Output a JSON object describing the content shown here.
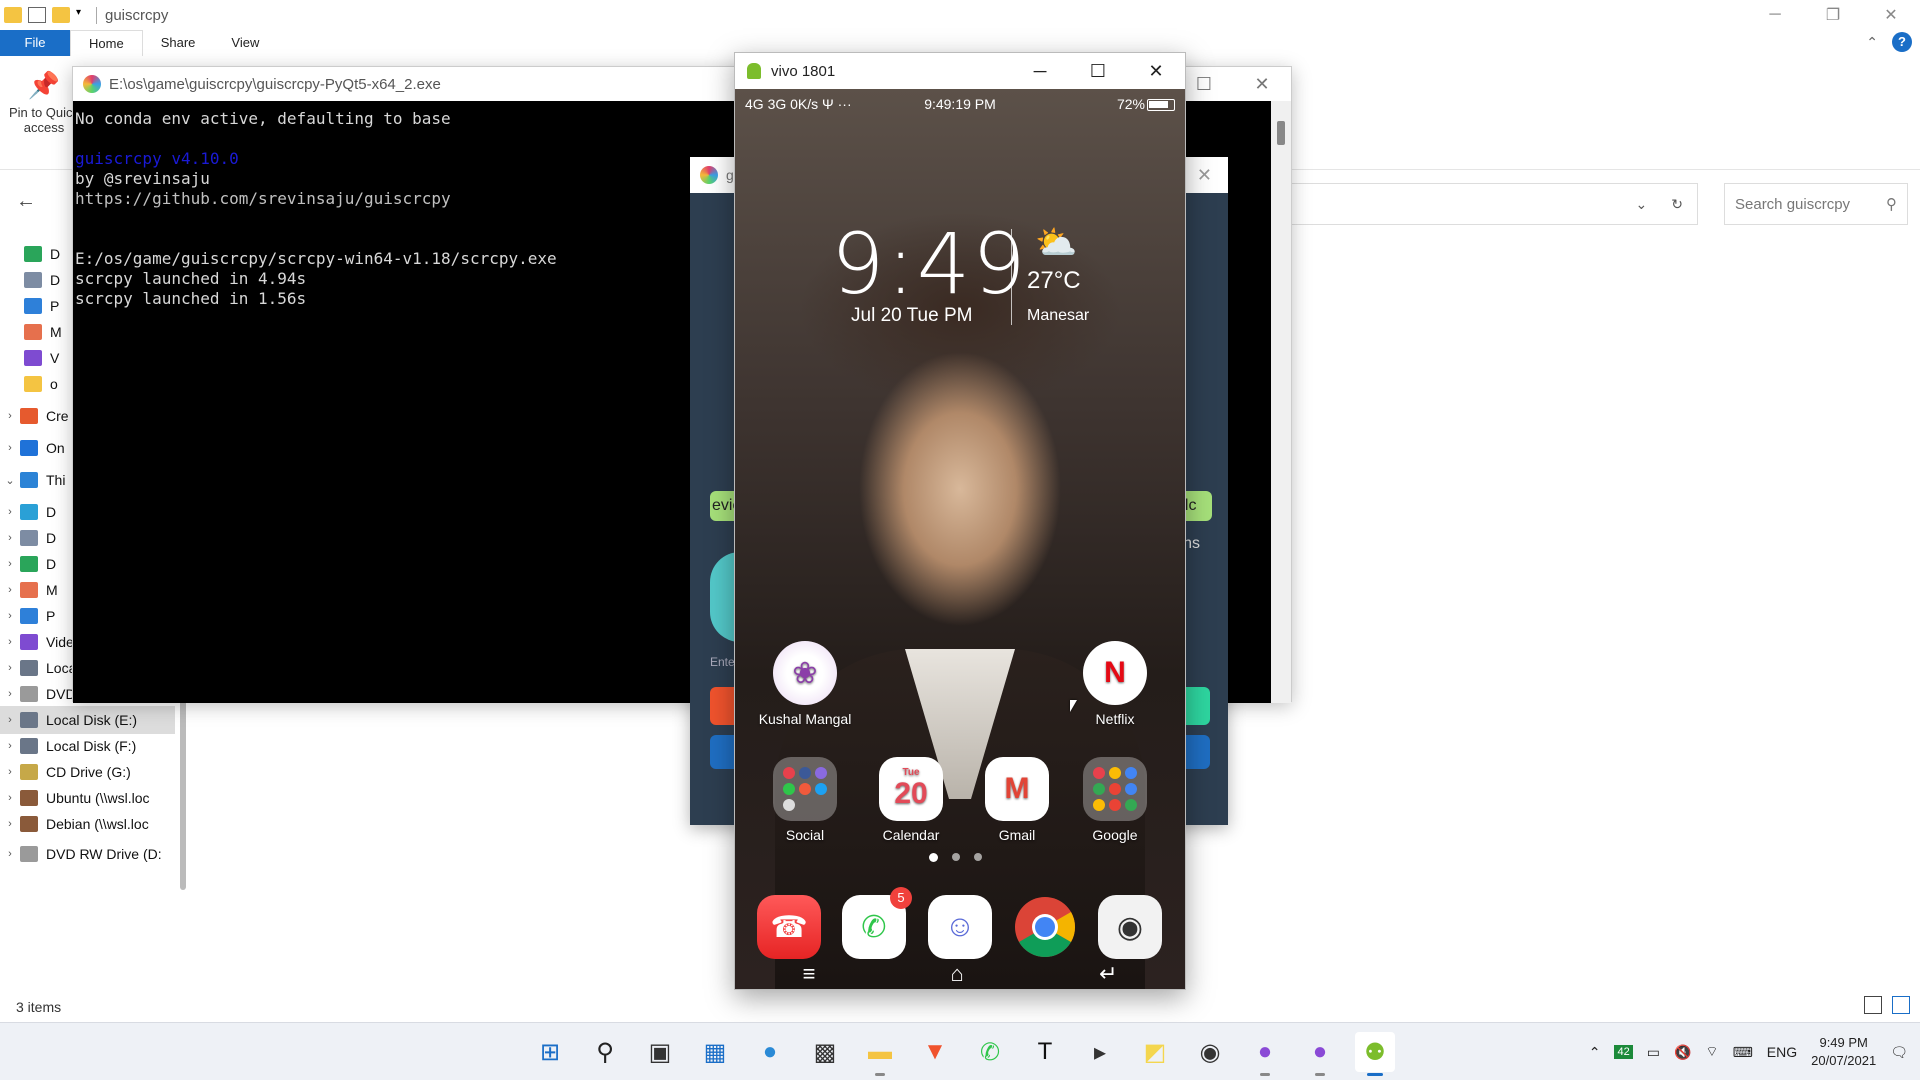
{
  "explorer": {
    "title": "guiscrcpy",
    "tabs": [
      "File",
      "Home",
      "Share",
      "View"
    ],
    "pin_label": "Pin to Quick access",
    "search_placeholder": "Search guiscrcpy",
    "status": "3 items",
    "nav_items": [
      {
        "label": "D",
        "color": "#2aa55a"
      },
      {
        "label": "D",
        "color": "#7d8ca3"
      },
      {
        "label": "P",
        "color": "#2e80d9"
      },
      {
        "label": "M",
        "color": "#e6704d"
      },
      {
        "label": "V",
        "color": "#7e4bd1"
      },
      {
        "label": "o",
        "color": "#f4c442"
      },
      {
        "label": "Cre",
        "color": "#e65a2e"
      },
      {
        "label": "On",
        "color": "#1f72d8"
      },
      {
        "label": "Thi",
        "color": "#2b83d6"
      },
      {
        "label": "D",
        "color": "#2aa0d6"
      },
      {
        "label": "D",
        "color": "#7d8ca3"
      },
      {
        "label": "D",
        "color": "#2aa55a"
      },
      {
        "label": "M",
        "color": "#e6704d"
      },
      {
        "label": "P",
        "color": "#2e80d9"
      },
      {
        "label": "Videos",
        "color": "#7e4bd1"
      },
      {
        "label": "Local Disk (C:)",
        "color": "#6a7688"
      },
      {
        "label": "DVD RW Drive (D",
        "color": "#9a9a9a"
      },
      {
        "label": "Local Disk (E:)",
        "color": "#6a7688"
      },
      {
        "label": "Local Disk (F:)",
        "color": "#6a7688"
      },
      {
        "label": "CD Drive (G:)",
        "color": "#c6a848"
      },
      {
        "label": "Ubuntu (\\\\wsl.loc",
        "color": "#8a5a3a"
      },
      {
        "label": "Debian (\\\\wsl.loc",
        "color": "#8a5a3a"
      },
      {
        "label": "DVD RW Drive (D:",
        "color": "#9a9a9a"
      }
    ]
  },
  "console": {
    "title": "E:\\os\\game\\guiscrcpy\\guiscrcpy-PyQt5-x64_2.exe",
    "lines": [
      {
        "text": "No conda env active, defaulting to base",
        "cls": ""
      },
      {
        "text": "",
        "cls": ""
      },
      {
        "text": "guiscrcpy v4.10.0",
        "cls": "blue"
      },
      {
        "text": "by @srevinsaju",
        "cls": ""
      },
      {
        "text": "https://github.com/srevinsaju/guiscrcpy",
        "cls": "grey"
      },
      {
        "text": "",
        "cls": ""
      },
      {
        "text": "",
        "cls": ""
      },
      {
        "text": "E:/os/game/guiscrcpy/scrcpy-win64-v1.18/scrcpy.exe",
        "cls": ""
      },
      {
        "text": "scrcpy launched in 4.94s",
        "cls": ""
      },
      {
        "text": "scrcpy launched in 1.56s",
        "cls": ""
      }
    ]
  },
  "gui": {
    "title": "g",
    "partial_labels": [
      "evic",
      "olc",
      "ns",
      "Ente"
    ]
  },
  "phone_window": {
    "title": "vivo 1801",
    "status_left": "4G 3G 0K/s Ψ ···",
    "status_time": "9:49:19 PM",
    "status_right": "72%",
    "clock": "9:49",
    "date": "Jul 20  Tue  PM",
    "temp": "27°C",
    "city": "Manesar",
    "apps_row1": [
      {
        "name": "Kushal Mangal",
        "glyph": "❀"
      },
      {
        "name": "Netflix",
        "glyph": "N"
      }
    ],
    "apps_row2": [
      {
        "name": "Social"
      },
      {
        "name": "Calendar",
        "day": "Tue",
        "date": "20"
      },
      {
        "name": "Gmail",
        "glyph": "M"
      },
      {
        "name": "Google"
      }
    ],
    "dock": [
      {
        "name": "phone",
        "glyph": "☎"
      },
      {
        "name": "whatsapp",
        "glyph": "✆",
        "badge": "5"
      },
      {
        "name": "discord",
        "glyph": "☺"
      },
      {
        "name": "chrome",
        "glyph": ""
      },
      {
        "name": "camera",
        "glyph": "◉"
      }
    ],
    "nav": [
      "≡",
      "⌂",
      "↵"
    ]
  },
  "taskbar": {
    "apps": [
      {
        "name": "start",
        "glyph": "⊞",
        "color": "#1a6ec7"
      },
      {
        "name": "search",
        "glyph": "⚲",
        "color": "#222"
      },
      {
        "name": "task-view",
        "glyph": "▣",
        "color": "#333"
      },
      {
        "name": "widgets",
        "glyph": "▦",
        "color": "#1a6ec7"
      },
      {
        "name": "edge",
        "glyph": "●",
        "color": "#2a8ad6"
      },
      {
        "name": "store",
        "glyph": "▩",
        "color": "#333"
      },
      {
        "name": "file-explorer",
        "glyph": "▬",
        "color": "#f4c442"
      },
      {
        "name": "brave",
        "glyph": "▼",
        "color": "#f0532d"
      },
      {
        "name": "whatsapp",
        "glyph": "✆",
        "color": "#2fc64a"
      },
      {
        "name": "typora",
        "glyph": "T",
        "color": "#111"
      },
      {
        "name": "terminal",
        "glyph": "▸",
        "color": "#333"
      },
      {
        "name": "sticky-notes",
        "glyph": "◩",
        "color": "#f4d64e"
      },
      {
        "name": "obs",
        "glyph": "◉",
        "color": "#333"
      },
      {
        "name": "guiscrcpy",
        "glyph": "●",
        "color": "#8a4ad6"
      },
      {
        "name": "guiscrcpy-2",
        "glyph": "●",
        "color": "#8a4ad6"
      },
      {
        "name": "android-scrcpy",
        "glyph": "⚉",
        "color": "#7cbd2c"
      }
    ],
    "lang": "ENG",
    "badge": "42",
    "time": "9:49 PM",
    "date": "20/07/2021"
  }
}
